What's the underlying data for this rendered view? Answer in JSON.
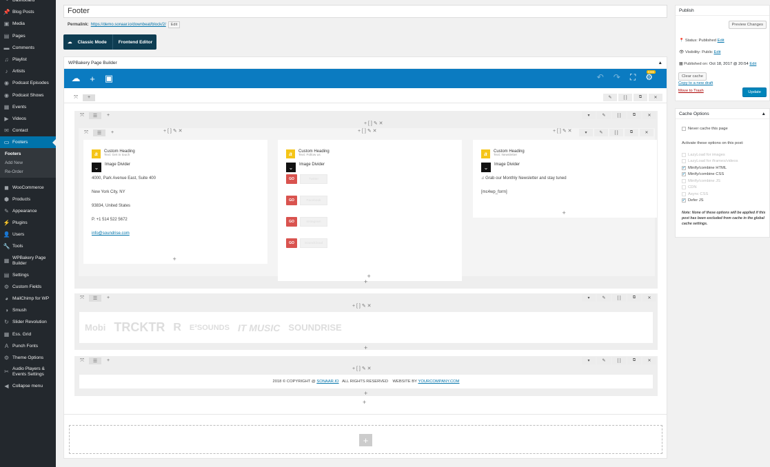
{
  "sidebar": {
    "items": [
      {
        "label": "Dashboard",
        "icon": "gauge-icon"
      },
      {
        "label": "Blog Posts",
        "icon": "pin-icon"
      },
      {
        "label": "Media",
        "icon": "media-icon"
      },
      {
        "label": "Pages",
        "icon": "page-icon"
      },
      {
        "label": "Comments",
        "icon": "comment-icon"
      },
      {
        "label": "Playlist",
        "icon": "playlist-icon"
      },
      {
        "label": "Artists",
        "icon": "artist-icon"
      },
      {
        "label": "Podcast Episodes",
        "icon": "podcast-icon"
      },
      {
        "label": "Podcast Shows",
        "icon": "podcast-icon"
      },
      {
        "label": "Events",
        "icon": "calendar-icon"
      },
      {
        "label": "Videos",
        "icon": "video-icon"
      },
      {
        "label": "Contact",
        "icon": "mail-icon"
      },
      {
        "label": "Footers",
        "icon": "footer-icon"
      }
    ],
    "submenu": [
      "Footers",
      "Add New",
      "Re-Order"
    ],
    "items2": [
      {
        "label": "WooCommerce",
        "icon": "woo-icon"
      },
      {
        "label": "Products",
        "icon": "box-icon"
      },
      {
        "label": "Appearance",
        "icon": "brush-icon"
      },
      {
        "label": "Plugins",
        "icon": "plug-icon"
      },
      {
        "label": "Users",
        "icon": "user-icon"
      },
      {
        "label": "Tools",
        "icon": "wrench-icon"
      },
      {
        "label": "WPBakery Page Builder",
        "icon": "wpb-icon"
      },
      {
        "label": "Settings",
        "icon": "settings-icon"
      },
      {
        "label": "Custom Fields",
        "icon": "gear-icon"
      },
      {
        "label": "MailChimp for WP",
        "icon": "mailchimp-icon"
      },
      {
        "label": "Smush",
        "icon": "smush-icon"
      },
      {
        "label": "Slider Revolution",
        "icon": "refresh-icon"
      },
      {
        "label": "Ess. Grid",
        "icon": "grid-icon"
      },
      {
        "label": "Punch Fonts",
        "icon": "font-icon"
      },
      {
        "label": "Theme Options",
        "icon": "gear-icon"
      },
      {
        "label": "Audio Players & Events Settings",
        "icon": "tools-icon"
      },
      {
        "label": "Collapse menu",
        "icon": "collapse-icon"
      }
    ]
  },
  "editor": {
    "title": "Footer",
    "permalink_label": "Permalink:",
    "permalink_url": "https://demo.sonaar.io/downbeat/block/2/",
    "edit": "Edit",
    "classic_mode": "Classic Mode",
    "frontend_editor": "Frontend Editor",
    "wpb_title": "WPBakery Page Builder",
    "badge": "CSS"
  },
  "columns": [
    {
      "heading": "Custom Heading",
      "sub": "Text: Get in touch",
      "divider": "Image Divider",
      "lines": [
        "4000, Park Avenue East, Suite 400",
        "New York City, NY",
        "93834, United States",
        "P. +1 514 522 5672",
        "info@soundrise.com"
      ]
    },
    {
      "heading": "Custom Heading",
      "sub": "Text: Follow us",
      "divider": "Image Divider",
      "go": "GO",
      "buttons": [
        "Twitter",
        "Facebook",
        "Instagram",
        "SoundCloud"
      ]
    },
    {
      "heading": "Custom Heading",
      "sub": "Text: Newsletter",
      "divider": "Image Divider",
      "lines": [
        "♫ Grab our Monthly Newsletter and stay tuned",
        "[mc4wp_form]"
      ]
    }
  ],
  "logos": [
    "Mobi",
    "TRCKTR",
    "R",
    "E²SOUNDS",
    "IT MUSIC",
    "SOUNDRISE"
  ],
  "copyright": {
    "pre": "2018 © COPYRIGHT @ ",
    "brand": "SONAAR.IO",
    "mid": "   ALL RIGHTS RESERVED    WEBSITE BY ",
    "company": "YOURCOMPANY.COM"
  },
  "publish": {
    "title": "Publish",
    "preview": "Preview Changes",
    "status_label": "Status:",
    "status": "Published",
    "visibility_label": "Visibility:",
    "visibility": "Public",
    "published_label": "Published on:",
    "published": "Oct 18, 2017 @ 20:54",
    "edit": "Edit",
    "clear_cache": "Clear cache",
    "copy_draft": "Copy to a new draft",
    "trash": "Move to Trash",
    "update": "Update"
  },
  "cache": {
    "title": "Cache Options",
    "never": "Never cache this page",
    "activate": "Activate these options on this post:",
    "options": [
      {
        "label": "LazyLoad for images",
        "checked": false,
        "disabled": true
      },
      {
        "label": "LazyLoad for iframes/videos",
        "checked": false,
        "disabled": true
      },
      {
        "label": "Minify/combine HTML",
        "checked": true,
        "disabled": false
      },
      {
        "label": "Minify/combine CSS",
        "checked": true,
        "disabled": false
      },
      {
        "label": "Minify/combine JS",
        "checked": false,
        "disabled": true
      },
      {
        "label": "CDN",
        "checked": false,
        "disabled": true
      },
      {
        "label": "Async CSS",
        "checked": false,
        "disabled": true
      },
      {
        "label": "Defer JS",
        "checked": true,
        "disabled": false
      }
    ],
    "note": "Note: None of these options will be applied if this post has been excluded from cache in the global cache settings."
  }
}
